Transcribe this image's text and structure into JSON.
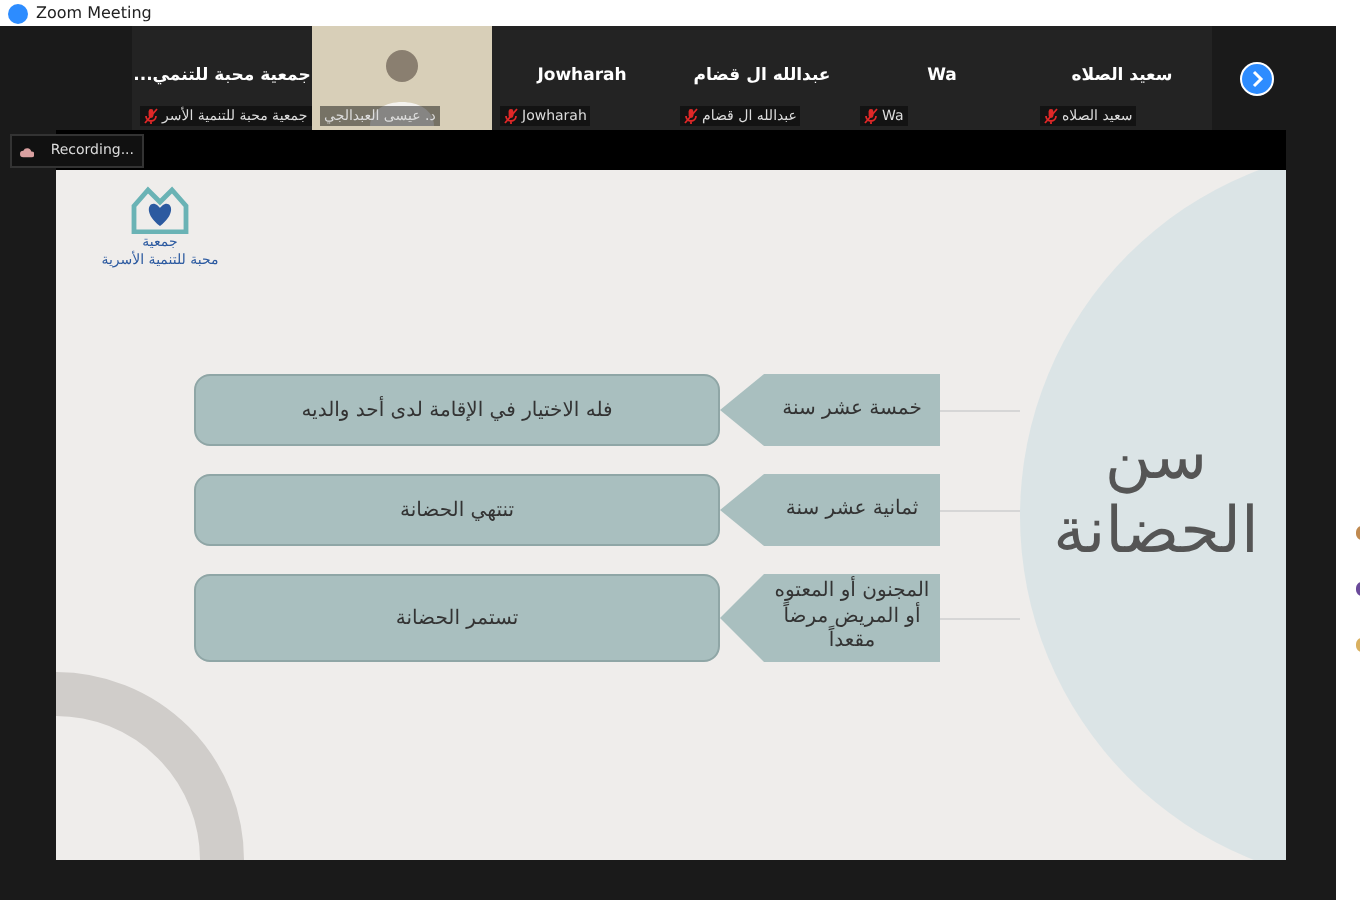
{
  "window": {
    "title": "Zoom Meeting"
  },
  "participants": [
    {
      "kind": "name",
      "display": "سعيد الصلاه",
      "label": "سعيد الصلاه",
      "muted": true
    },
    {
      "kind": "name",
      "display": "Wa",
      "label": "Wa",
      "muted": true
    },
    {
      "kind": "name",
      "display": "عبدالله ال قضام",
      "label": "عبدالله ال قضام",
      "muted": true
    },
    {
      "kind": "name",
      "display": "Jowharah",
      "label": "Jowharah",
      "muted": true
    },
    {
      "kind": "video",
      "label": "د. عيسى العبدالجي",
      "muted": false
    },
    {
      "kind": "name",
      "display": "جمعية محبة للتنمي...",
      "label": "جمعية محبة للتنمية الأسر",
      "muted": true
    }
  ],
  "recording": {
    "label": "Recording..."
  },
  "slide": {
    "logo_lines": [
      "جمعية",
      "محبة للتنمية الأسرية"
    ],
    "title": "سن الحضانة",
    "rows": [
      {
        "condition": "خمسة عشر سنة",
        "result": "فله الاختيار في الإقامة لدى أحد والديه"
      },
      {
        "condition": "ثمانية عشر سنة",
        "result": "تنتهي الحضانة"
      },
      {
        "condition": "المجنون أو المعتوه أو المريض مرضاً مقعداً",
        "result": "تستمر الحضانة"
      }
    ]
  }
}
